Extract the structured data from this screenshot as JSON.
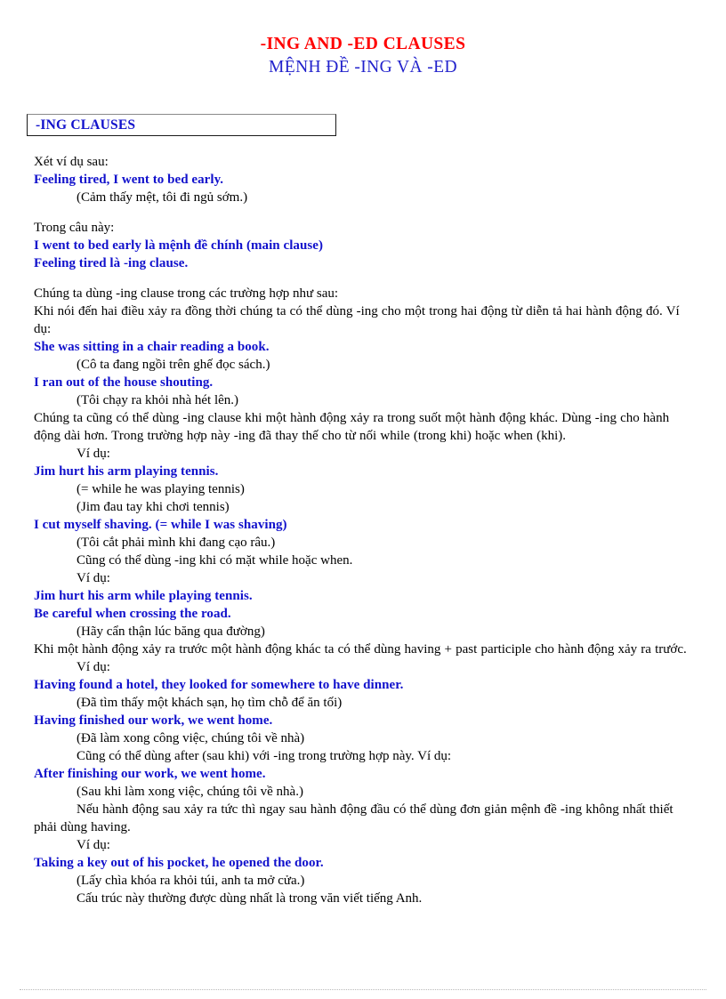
{
  "document": {
    "title_en": "-ING AND -ED CLAUSES",
    "title_vi": "MỆNH ĐỀ -ING VÀ -ED",
    "colors": {
      "title_en": "#ff0000",
      "title_vi": "#2222cc",
      "example_blue": "#1111cc",
      "body_black": "#000000"
    },
    "section_heading": "-ING CLAUSES",
    "lines": [
      {
        "id": "l01",
        "text": "Xét ví dụ sau:",
        "style": "black"
      },
      {
        "id": "l02",
        "text": "Feeling tired, I went to bed early.",
        "style": "blue"
      },
      {
        "id": "l03",
        "text": "(Cảm thấy mệt, tôi đi ngủ sớm.)",
        "style": "black-indent"
      },
      {
        "id": "l04",
        "text": "Trong câu này:",
        "style": "black"
      },
      {
        "id": "l05",
        "text": "I went to bed early là mệnh đề chính (main clause)",
        "style": "blue"
      },
      {
        "id": "l06",
        "text": "Feeling tired là -ing clause.",
        "style": "blue"
      },
      {
        "id": "l07",
        "text": "Chúng ta dùng -ing clause trong các trường hợp như sau:",
        "style": "black"
      },
      {
        "id": "l08",
        "text": "Khi nói đến hai điều xảy ra đồng thời chúng ta có thể dùng -ing cho một trong hai động từ diễn tả hai hành động đó. Ví dụ:",
        "style": "black-wrap"
      },
      {
        "id": "l09",
        "text": "She was sitting in a chair reading a book.",
        "style": "blue"
      },
      {
        "id": "l10",
        "text": "(Cô ta đang ngồi trên ghế đọc sách.)",
        "style": "black-indent"
      },
      {
        "id": "l11",
        "text": "I ran out of the house shouting.",
        "style": "blue"
      },
      {
        "id": "l12",
        "text": "(Tôi chạy ra khỏi nhà hét lên.)",
        "style": "black-indent"
      },
      {
        "id": "l13",
        "text": "Chúng ta cũng có thể dùng -ing clause khi một hành động xảy ra trong suốt một hành động khác. Dùng -ing cho hành động dài hơn. Trong trường hợp này -ing đã thay thế cho từ nối while (trong khi) hoặc when (khi).",
        "style": "black-wrap"
      },
      {
        "id": "l14",
        "text": "Ví dụ:",
        "style": "black-indent"
      },
      {
        "id": "l15",
        "text": "Jim hurt his arm playing tennis.",
        "style": "blue"
      },
      {
        "id": "l16",
        "text": "(= while he was playing tennis)",
        "style": "black-indent"
      },
      {
        "id": "l17",
        "text": "(Jim đau tay khi chơi tennis)",
        "style": "black-indent"
      },
      {
        "id": "l18",
        "text": "I cut myself shaving. (= while I was shaving)",
        "style": "blue"
      },
      {
        "id": "l19",
        "text": "(Tôi cắt phải mình khi đang cạo râu.)",
        "style": "black-indent"
      },
      {
        "id": "l20",
        "text": "Cũng có thể dùng -ing khi có mặt while hoặc when.",
        "style": "black-indent"
      },
      {
        "id": "l21",
        "text": "Ví dụ:",
        "style": "black-indent"
      },
      {
        "id": "l22",
        "text": "Jim hurt his arm while playing tennis.",
        "style": "blue"
      },
      {
        "id": "l23",
        "text": "Be careful when crossing the road.",
        "style": "blue"
      },
      {
        "id": "l24",
        "text": "(Hãy cẩn thận lúc băng qua đường)",
        "style": "black-indent"
      },
      {
        "id": "l25",
        "text": "Khi một hành động xảy ra trước một hành động khác ta có thể dùng having + past participle cho hành động xảy ra trước.",
        "style": "black-wrap"
      },
      {
        "id": "l26",
        "text": "Ví dụ:",
        "style": "black-indent"
      },
      {
        "id": "l27",
        "text": "Having found a hotel, they looked for somewhere to have dinner.",
        "style": "blue"
      },
      {
        "id": "l28",
        "text": "(Đã tìm thấy một khách sạn, họ tìm chỗ để ăn tối)",
        "style": "black-indent"
      },
      {
        "id": "l29",
        "text": "Having finished our work, we went home.",
        "style": "blue"
      },
      {
        "id": "l30",
        "text": "(Đã làm xong công việc, chúng tôi về nhà)",
        "style": "black-indent"
      },
      {
        "id": "l31",
        "text": "Cũng có thể dùng after (sau khi) với -ing trong trường hợp này. Ví dụ:",
        "style": "black-indent"
      },
      {
        "id": "l32",
        "text": "After finishing our work, we went home.",
        "style": "blue"
      },
      {
        "id": "l33",
        "text": "(Sau khi làm xong việc, chúng tôi về nhà.)",
        "style": "black-indent"
      },
      {
        "id": "l34",
        "text": "Nếu hành động sau xảy ra tức thì ngay sau hành động đầu có thể dùng đơn giản mệnh đề -ing không nhất thiết phải dùng having.",
        "style": "black-wrap-first-indent"
      },
      {
        "id": "l35",
        "text": "Ví dụ:",
        "style": "black-indent"
      },
      {
        "id": "l36",
        "text": "Taking a key out of his pocket, he opened the door.",
        "style": "blue"
      },
      {
        "id": "l37",
        "text": "(Lấy chìa khóa ra khỏi túi, anh ta mở cửa.)",
        "style": "black-indent"
      },
      {
        "id": "l38",
        "text": "Cấu trúc này thường được dùng nhất là trong văn viết tiếng Anh.",
        "style": "black-indent"
      }
    ]
  }
}
